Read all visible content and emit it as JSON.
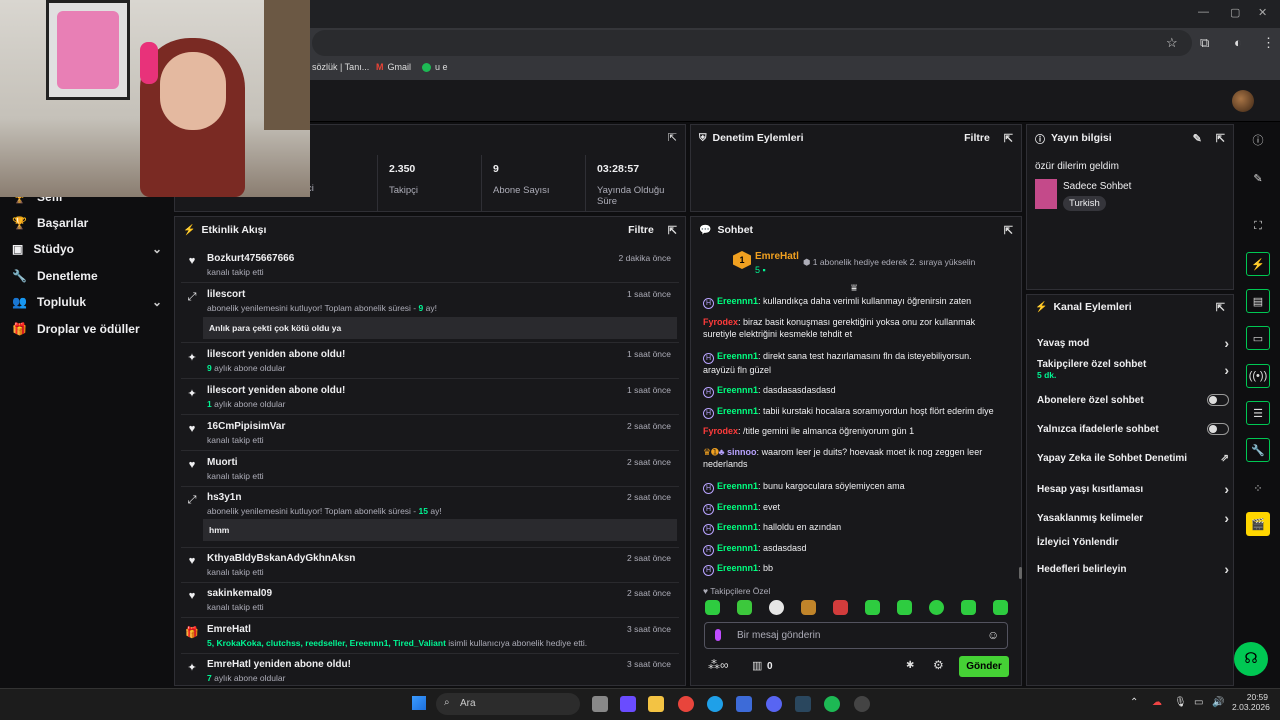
{
  "browser": {
    "bookmarks": [
      {
        "label": "sözlük | Tanı..."
      },
      {
        "label": "Gmail"
      },
      {
        "label": "u e"
      }
    ]
  },
  "sidebar": {
    "items": [
      {
        "label": "Sefil",
        "icon": "trophy-icon"
      },
      {
        "label": "Başarılar",
        "icon": "trophy-icon"
      },
      {
        "label": "Stüdyo",
        "icon": "film-icon",
        "chevron": true
      },
      {
        "label": "Denetleme",
        "icon": "wrench-icon"
      },
      {
        "label": "Topluluk",
        "icon": "people-icon",
        "chevron": true
      },
      {
        "label": "Droplar ve ödüller",
        "icon": "gift-icon"
      }
    ]
  },
  "stats": {
    "partial_label": "ci",
    "items": [
      {
        "value": "2.350",
        "label": "Takipçi"
      },
      {
        "value": "9",
        "label": "Abone Sayısı"
      },
      {
        "value": "03:28:57",
        "label": "Yayında Olduğu Süre"
      }
    ]
  },
  "mod_actions": {
    "title": "Denetim Eylemleri",
    "filter": "Filtre"
  },
  "stream_info": {
    "title": "Yayın bilgisi",
    "stream_title": "özür dilerim geldim",
    "category": "Sadece Sohbet",
    "tag": "Turkish"
  },
  "activity": {
    "title": "Etkinlik Akışı",
    "filter": "Filtre",
    "items": [
      {
        "name": "Bozkurt475667666",
        "sub": "kanalı takip etti",
        "time": "2 dakika önce",
        "icon": "heart-icon"
      },
      {
        "name": "lilescort",
        "sub_pre": "abonelik yenilemesini kutluyor! Toplam abonelik süresi - ",
        "sub_hl": "9",
        "sub_post": " ay!",
        "time": "1 saat önce",
        "icon": "resub-icon",
        "message": "Anlık para çekti çok kötü oldu ya"
      },
      {
        "name": "lilescort yeniden abone oldu!",
        "sub_hl": "9",
        "sub_post": " aylık abone oldular",
        "time": "1 saat önce",
        "icon": "sparkle-icon"
      },
      {
        "name": "lilescort yeniden abone oldu!",
        "sub_hl": "1",
        "sub_post": " aylık abone oldular",
        "time": "1 saat önce",
        "icon": "sparkle-icon"
      },
      {
        "name": "16CmPipisimVar",
        "sub": "kanalı takip etti",
        "time": "2 saat önce",
        "icon": "heart-icon"
      },
      {
        "name": "Muorti",
        "sub": "kanalı takip etti",
        "time": "2 saat önce",
        "icon": "heart-icon"
      },
      {
        "name": "hs3y1n",
        "sub_pre": "abonelik yenilemesini kutluyor! Toplam abonelik süresi - ",
        "sub_hl": "15",
        "sub_post": " ay!",
        "time": "2 saat önce",
        "icon": "resub-icon",
        "message": "hmm"
      },
      {
        "name": "KthyaBldyBskanAdyGkhnAksn",
        "sub": "kanalı takip etti",
        "time": "2 saat önce",
        "icon": "heart-icon"
      },
      {
        "name": "sakinkemal09",
        "sub": "kanalı takip etti",
        "time": "2 saat önce",
        "icon": "heart-icon"
      },
      {
        "name": "EmreHatl",
        "sub_hl": "5, KrokaKoka, clutchss, reedseller, Ereennn1, Tired_Valiant",
        "sub_post": " isimli kullanıcıya abonelik hediye etti.",
        "time": "3 saat önce",
        "icon": "gift-icon"
      },
      {
        "name": "EmreHatl yeniden abone oldu!",
        "sub_hl": "7",
        "sub_post": " aylık abone oldular",
        "time": "3 saat önce",
        "icon": "sparkle-icon"
      }
    ]
  },
  "chat": {
    "title": "Sohbet",
    "pinned_user": "EmreHatl",
    "pinned_count": "5",
    "pinned_rank": "1",
    "pinned_msg": "1 abonelik hediye ederek 2. sıraya yükselin",
    "messages": [
      {
        "user": "Ereennn1",
        "color": "green",
        "badge": true,
        "text": "kullandıkça daha verimli kullanmayı öğrenirsin zaten"
      },
      {
        "user": "Fyrodex",
        "color": "red",
        "badge": false,
        "text": "biraz basit konuşması gerektiğini yoksa onu zor kullanmak suretiyle elektriğini kesmekle tehdit et"
      },
      {
        "user": "Ereennn1",
        "color": "green",
        "badge": true,
        "text": "direkt sana test hazırlamasını fln da isteyebiliyorsun. arayüzü fln güzel"
      },
      {
        "user": "Ereennn1",
        "color": "green",
        "badge": true,
        "text": "dasdasasdasdasd"
      },
      {
        "user": "Ereennn1",
        "color": "green",
        "badge": true,
        "text": "tabii kurstaki hocalara soramıyordun hoşt flört ederim diye"
      },
      {
        "user": "Fyrodex",
        "color": "red",
        "badge": false,
        "text": "/title gemini ile almanca öğreniyorum gün 1"
      },
      {
        "user": "sinnoo",
        "color": "purple",
        "badge": false,
        "text": "waarom leer je duits? hoevaak moet ik nog zeggen leer nederlands"
      },
      {
        "user": "Ereennn1",
        "color": "green",
        "badge": true,
        "text": "bunu kargoculara söylemiycen ama"
      },
      {
        "user": "Ereennn1",
        "color": "green",
        "badge": true,
        "text": "evet"
      },
      {
        "user": "Ereennn1",
        "color": "green",
        "badge": true,
        "text": "halloldu en azından"
      },
      {
        "user": "Ereennn1",
        "color": "green",
        "badge": true,
        "text": "asdasdasd"
      },
      {
        "user": "Ereennn1",
        "color": "green",
        "badge": true,
        "text": "bb"
      }
    ],
    "followers_only": "Takipçilere Özel",
    "input_placeholder": "Bir mesaj gönderin",
    "points": "0",
    "send": "Gönder"
  },
  "channel_actions": {
    "title": "Kanal Eylemleri",
    "items": [
      {
        "label": "Yavaş mod",
        "control": "chevron"
      },
      {
        "label": "Takipçilere özel sohbet",
        "sub": "5 dk.",
        "control": "chevron"
      },
      {
        "label": "Abonelere özel sohbet",
        "control": "toggle"
      },
      {
        "label": "Yalnızca ifadelerle sohbet",
        "control": "toggle"
      },
      {
        "label": "Yapay Zeka ile Sohbet Denetimi",
        "control": "external"
      },
      {
        "label": "Hesap yaşı kısıtlaması",
        "control": "chevron"
      },
      {
        "label": "Yasaklanmış kelimeler",
        "control": "chevron"
      },
      {
        "label": "İzleyici Yönlendir",
        "control": "none"
      },
      {
        "label": "Hedefleri belirleyin",
        "control": "chevron"
      }
    ]
  },
  "taskbar": {
    "search": "Ara",
    "time": "20:59",
    "date": "2.03.2026"
  },
  "colors": {
    "accent_green": "#00f593",
    "send_green": "#45d135",
    "panel": "#18181b"
  }
}
